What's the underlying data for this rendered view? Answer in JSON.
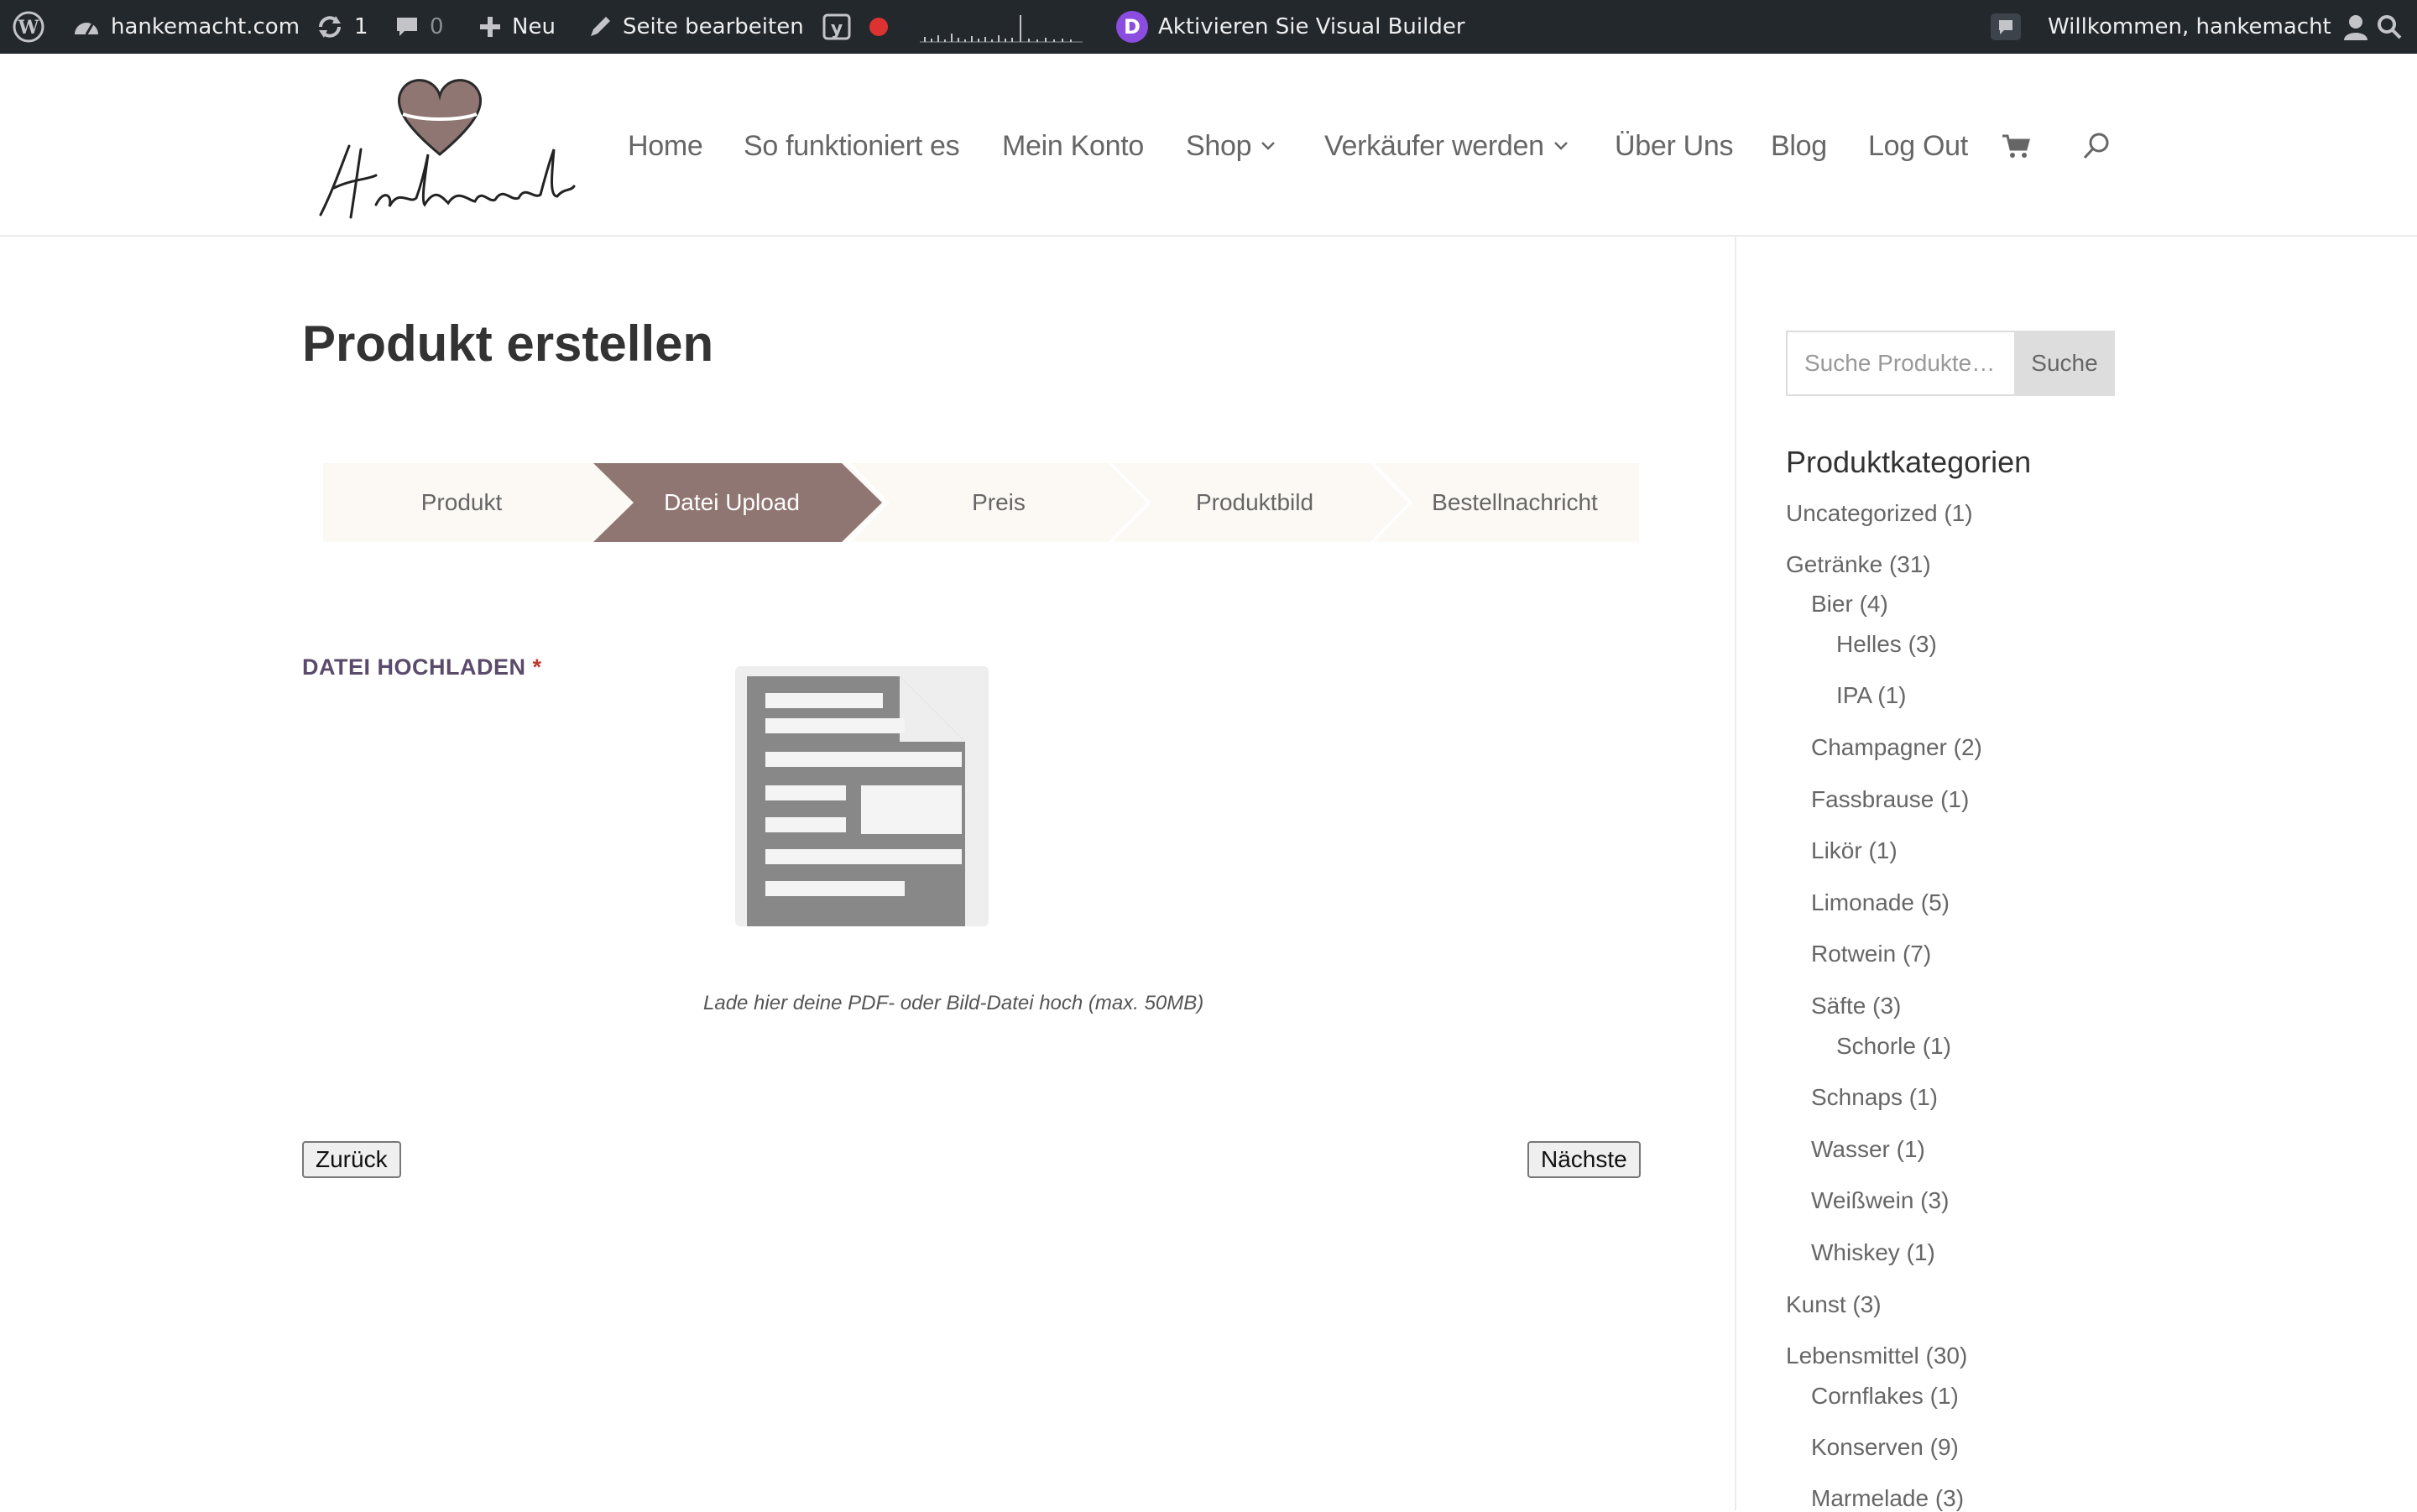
{
  "admin_bar": {
    "site_name": "hankemacht.com",
    "updates_count": "1",
    "comments_count": "0",
    "new_label": "Neu",
    "edit_page_label": "Seite bearbeiten",
    "visual_builder_label": "Aktivieren Sie Visual Builder",
    "divi_letter": "D",
    "greeting": "Willkommen, hankemacht"
  },
  "nav": {
    "items": [
      "Home",
      "So funktioniert es",
      "Mein Konto",
      "Shop",
      "Verkäufer werden",
      "Über Uns",
      "Blog",
      "Log Out"
    ]
  },
  "brand": {
    "accent": "#8f7672",
    "step_bg": "#fcf8f4"
  },
  "page": {
    "title": "Produkt erstellen"
  },
  "steps": [
    "Produkt",
    "Datei Upload",
    "Preis",
    "Produktbild",
    "Bestellnachricht"
  ],
  "active_step": "Datei Upload",
  "upload": {
    "label": "DATEI HOCHLADEN",
    "required_mark": "*",
    "hint": "Lade hier deine PDF- oder Bild-Datei hoch (max. 50MB)"
  },
  "buttons": {
    "back": "Zurück",
    "next": "Nächste"
  },
  "sidebar": {
    "search_placeholder": "Suche Produkte…",
    "search_button": "Suche",
    "categories_title": "Produktkategorien",
    "categories": [
      "Uncategorized (1)",
      "Getränke (31)",
      "Bier (4)",
      "Helles (3)",
      "IPA (1)",
      "Champagner (2)",
      "Fassbrause (1)",
      "Likör (1)",
      "Limonade (5)",
      "Rotwein (7)",
      "Säfte (3)",
      "Schorle (1)",
      "Schnaps (1)",
      "Wasser (1)",
      "Weißwein (3)",
      "Whiskey (1)",
      "Kunst (3)",
      "Lebensmittel (30)",
      "Cornflakes (1)",
      "Konserven (9)",
      "Marmelade (3)"
    ]
  }
}
